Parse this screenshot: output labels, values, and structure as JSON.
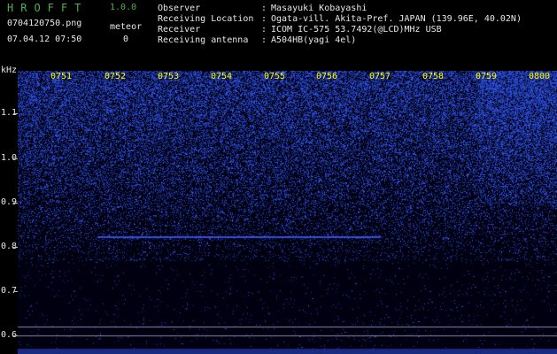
{
  "app": {
    "title": "HROFFT",
    "version": "1.0.0"
  },
  "file": {
    "name": "0704120750.png",
    "datetime": "07.04.12 07:50"
  },
  "meteor": {
    "label": "meteor",
    "count": "0"
  },
  "info": [
    {
      "label": "Observer",
      "value": "Masayuki Kobayashi"
    },
    {
      "label": "Receiving Location",
      "value": "Ogata-vill. Akita-Pref. JAPAN (139.96E, 40.02N)"
    },
    {
      "label": "Receiver",
      "value": "ICOM IC-575 53.7492(@LCD)MHz USB"
    },
    {
      "label": "Receiving antenna",
      "value": "A504HB(yagi 4el)"
    }
  ],
  "axis": {
    "y_unit": "kHz",
    "y_labels": [
      "1.1",
      "1.0",
      "0.9",
      "0.8",
      "0.7",
      "0.6"
    ],
    "x_labels": [
      "0751",
      "0752",
      "0753",
      "0754",
      "0755",
      "0756",
      "0757",
      "0758",
      "0759",
      "0800"
    ]
  },
  "colors": {
    "accent_green": "#4caf50",
    "time_label": "#ffff00",
    "signal": "#4060ff"
  }
}
